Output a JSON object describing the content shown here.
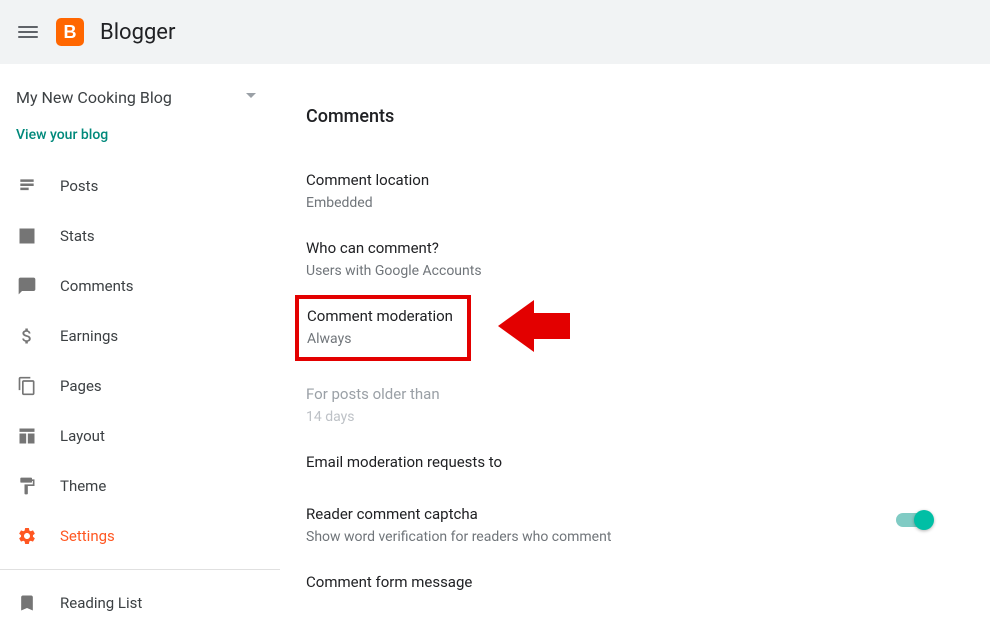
{
  "header": {
    "brand": "Blogger"
  },
  "sidebar": {
    "blog_name": "My New Cooking Blog",
    "view_blog_label": "View your blog",
    "items": [
      {
        "label": "Posts"
      },
      {
        "label": "Stats"
      },
      {
        "label": "Comments"
      },
      {
        "label": "Earnings"
      },
      {
        "label": "Pages"
      },
      {
        "label": "Layout"
      },
      {
        "label": "Theme"
      },
      {
        "label": "Settings"
      },
      {
        "label": "Reading List"
      }
    ]
  },
  "main": {
    "section_title": "Comments",
    "rows": {
      "location": {
        "label": "Comment location",
        "value": "Embedded"
      },
      "who": {
        "label": "Who can comment?",
        "value": "Users with Google Accounts"
      },
      "moderation": {
        "label": "Comment moderation",
        "value": "Always"
      },
      "older": {
        "label": "For posts older than",
        "value": "14 days"
      },
      "email": {
        "label": "Email moderation requests to"
      },
      "captcha": {
        "label": "Reader comment captcha",
        "value": "Show word verification for readers who comment"
      },
      "form_msg": {
        "label": "Comment form message"
      }
    }
  }
}
